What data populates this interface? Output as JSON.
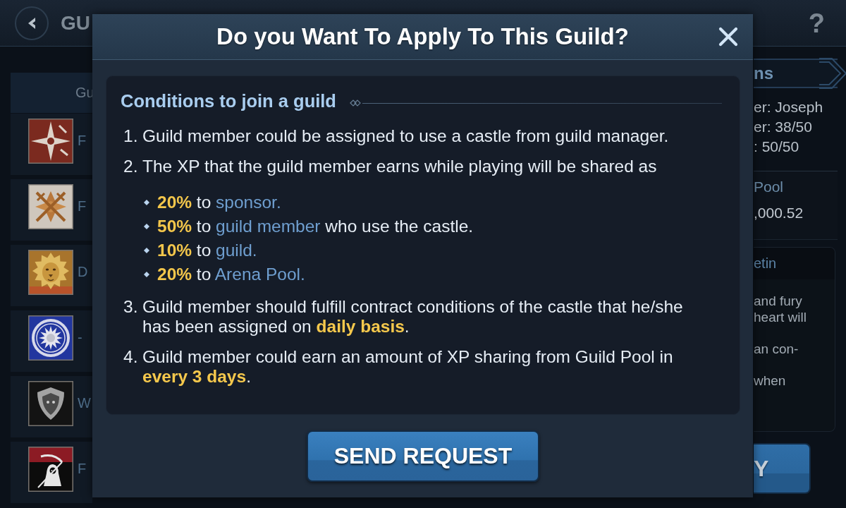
{
  "header": {
    "title": "GU",
    "help": "?"
  },
  "guild_list": {
    "header": "Gu",
    "rows": [
      {
        "kind": "star",
        "name": "F"
      },
      {
        "kind": "swords",
        "name": "F"
      },
      {
        "kind": "lion",
        "name": "D"
      },
      {
        "kind": "sun",
        "name": "-"
      },
      {
        "kind": "shield",
        "name": "W"
      },
      {
        "kind": "reaper",
        "name": "F"
      }
    ]
  },
  "info_panel": {
    "banner": "ns",
    "details": [
      "er: Joseph",
      "er: 38/50",
      ": 50/50"
    ],
    "pool": {
      "label": "Pool",
      "value": ",000.52"
    },
    "bulletin": {
      "title": "etin",
      "paragraphs": [
        [
          "and fury",
          "heart will"
        ],
        [
          "an con-"
        ],
        [
          "when"
        ]
      ]
    },
    "button": "Y"
  },
  "dialog": {
    "title": "Do you Want To Apply To This Guild?",
    "heading": "Conditions to join a guild",
    "conditions": [
      {
        "number": "1.",
        "text": "Guild member could be assigned to use a castle from guild manager."
      },
      {
        "number": "2.",
        "text": "The XP that the guild member earns while playing will be shared as",
        "shares": [
          {
            "percent": "20%",
            "connector": "to",
            "target": "sponsor."
          },
          {
            "percent": "50%",
            "connector": "to",
            "target": "guild member",
            "rest": "who use the castle."
          },
          {
            "percent": "10%",
            "connector": "to",
            "target": "guild."
          },
          {
            "percent": "20%",
            "connector": "to",
            "target": "Arena Pool."
          }
        ]
      },
      {
        "number": "3.",
        "text": "Guild member should fulfill contract conditions of the castle that he/she has been assigned on **daily basis**."
      },
      {
        "number": "4.",
        "text": "Guild member could earn an amount of XP sharing from Guild Pool in **every 3 days**."
      }
    ],
    "button": "SEND REQUEST"
  }
}
